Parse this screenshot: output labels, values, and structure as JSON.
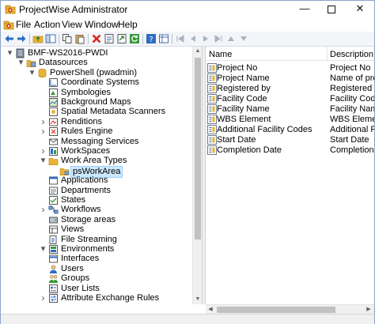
{
  "window": {
    "title": "ProjectWise Administrator",
    "minimize_glyph": "—",
    "close_glyph": "✕"
  },
  "menu": [
    "File",
    "Action",
    "View",
    "Window",
    "Help"
  ],
  "colors": {
    "folder": "#e8b436",
    "folder_dark": "#c48f1c",
    "accent_blue": "#2b6cc4",
    "selection_bg": "#cce8ff",
    "red_x": "#d8261d",
    "green": "#3a9a3a"
  },
  "tree": [
    {
      "label": "BMF-WS2016-PWDI",
      "level": 0,
      "expander": "expanded",
      "icon": "server-icon"
    },
    {
      "label": "Datasources",
      "level": 1,
      "expander": "expanded",
      "icon": "datasources-icon"
    },
    {
      "label": "PowerShell (pwadmin)",
      "level": 2,
      "expander": "expanded",
      "icon": "datasource-icon"
    },
    {
      "label": "Coordinate Systems",
      "level": 3,
      "expander": "none",
      "icon": "coordinate-systems-icon"
    },
    {
      "label": "Symbologies",
      "level": 3,
      "expander": "none",
      "icon": "symbologies-icon"
    },
    {
      "label": "Background Maps",
      "level": 3,
      "expander": "none",
      "icon": "background-maps-icon"
    },
    {
      "label": "Spatial Metadata Scanners",
      "level": 3,
      "expander": "none",
      "icon": "scanner-icon"
    },
    {
      "label": "Renditions",
      "level": 3,
      "expander": "collapsed",
      "icon": "renditions-icon"
    },
    {
      "label": "Rules Engine",
      "level": 3,
      "expander": "collapsed",
      "icon": "rules-engine-icon"
    },
    {
      "label": "Messaging Services",
      "level": 3,
      "expander": "none",
      "icon": "messaging-icon"
    },
    {
      "label": "WorkSpaces",
      "level": 3,
      "expander": "collapsed",
      "icon": "workspaces-icon"
    },
    {
      "label": "Work Area Types",
      "level": 3,
      "expander": "expanded",
      "icon": "folder-icon"
    },
    {
      "label": "psWorkArea",
      "level": 4,
      "expander": "none",
      "icon": "work-area-icon",
      "selected": true
    },
    {
      "label": "Applications",
      "level": 3,
      "expander": "none",
      "icon": "applications-icon"
    },
    {
      "label": "Departments",
      "level": 3,
      "expander": "none",
      "icon": "departments-icon"
    },
    {
      "label": "States",
      "level": 3,
      "expander": "none",
      "icon": "states-icon"
    },
    {
      "label": "Workflows",
      "level": 3,
      "expander": "collapsed",
      "icon": "workflows-icon"
    },
    {
      "label": "Storage areas",
      "level": 3,
      "expander": "none",
      "icon": "storage-icon"
    },
    {
      "label": "Views",
      "level": 3,
      "expander": "none",
      "icon": "views-icon"
    },
    {
      "label": "File Streaming",
      "level": 3,
      "expander": "none",
      "icon": "file-streaming-icon"
    },
    {
      "label": "Environments",
      "level": 3,
      "expander": "expanded",
      "icon": "environments-icon"
    },
    {
      "label": "Interfaces",
      "level": 3,
      "expander": "none",
      "icon": "interfaces-icon"
    },
    {
      "label": "Users",
      "level": 3,
      "expander": "none",
      "icon": "users-icon"
    },
    {
      "label": "Groups",
      "level": 3,
      "expander": "none",
      "icon": "groups-icon"
    },
    {
      "label": "User Lists",
      "level": 3,
      "expander": "none",
      "icon": "user-lists-icon"
    },
    {
      "label": "Attribute Exchange Rules",
      "level": 3,
      "expander": "collapsed",
      "icon": "attribute-exchange-icon"
    }
  ],
  "list": {
    "columns": [
      "Name",
      "Description"
    ],
    "rows": [
      {
        "name": "Project No",
        "description": "Project No"
      },
      {
        "name": "Project Name",
        "description": "Name of pro"
      },
      {
        "name": "Registered by",
        "description": "Registered by"
      },
      {
        "name": "Facility Code",
        "description": "Facility Code"
      },
      {
        "name": "Facility Name",
        "description": "Facility Name"
      },
      {
        "name": "WBS Element",
        "description": "WBS Element"
      },
      {
        "name": "Additional Facility Codes",
        "description": "Additional Fa"
      },
      {
        "name": "Start Date",
        "description": "Start Date"
      },
      {
        "name": "Completion Date",
        "description": "Completion"
      }
    ]
  }
}
